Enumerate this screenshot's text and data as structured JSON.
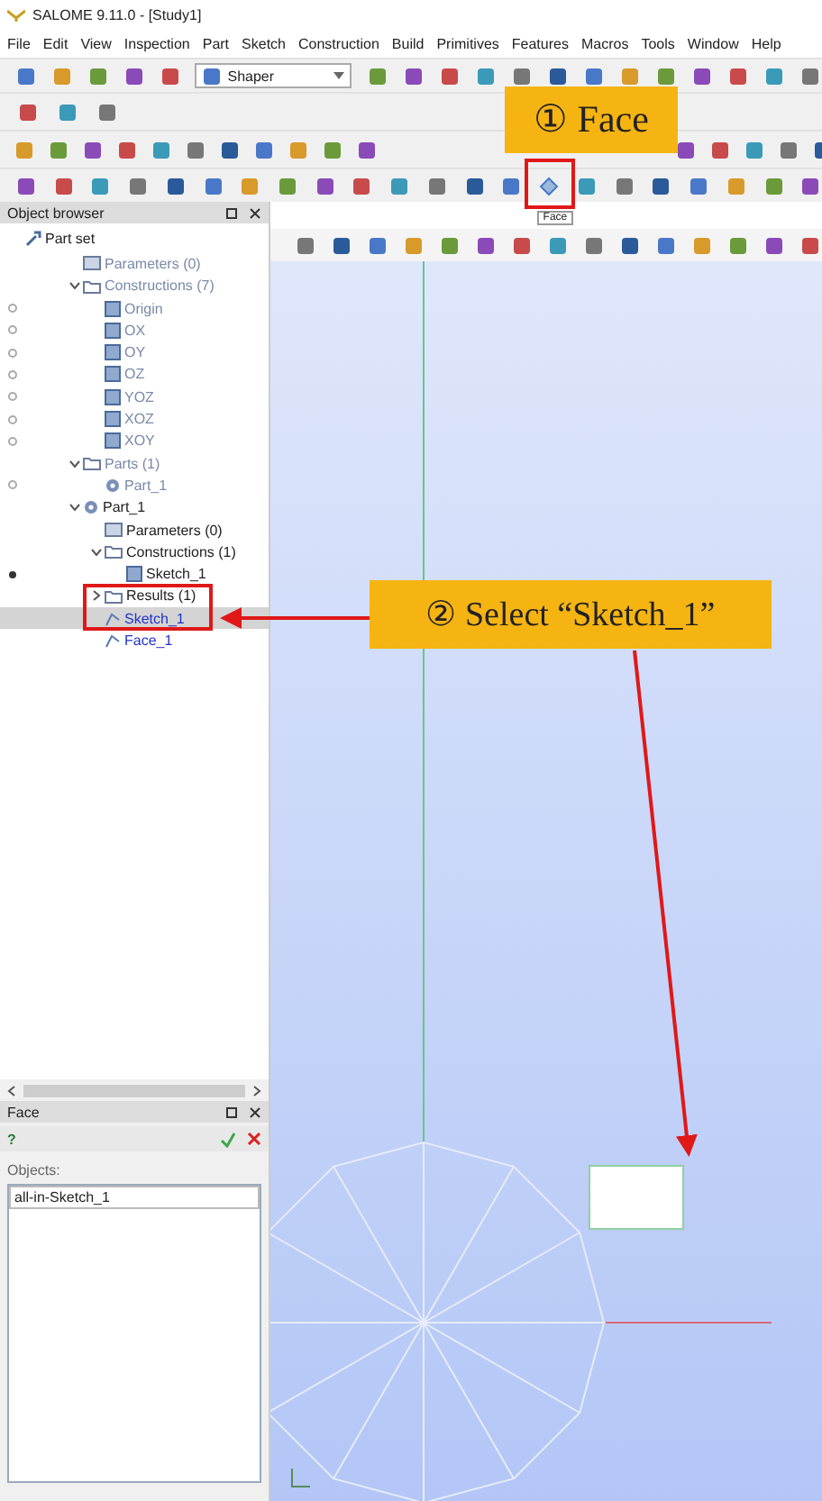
{
  "window": {
    "title": "SALOME 9.11.0 - [Study1]"
  },
  "menu": [
    "File",
    "Edit",
    "View",
    "Inspection",
    "Part",
    "Sketch",
    "Construction",
    "Build",
    "Primitives",
    "Features",
    "Macros",
    "Tools",
    "Window",
    "Help"
  ],
  "module_selector": {
    "value": "Shaper"
  },
  "tooltip": "Face",
  "object_browser": {
    "title": "Object browser",
    "tree": [
      {
        "label": "Part set",
        "kind": "root",
        "selected": false,
        "dimmed": false,
        "children": [
          {
            "label": "Parameters (0)",
            "kind": "params",
            "selected": false,
            "dimmed": true
          },
          {
            "label": "Constructions (7)",
            "kind": "folder",
            "selected": false,
            "dimmed": true,
            "expanded": true,
            "children": [
              {
                "label": "Origin",
                "kind": "construction",
                "selected": false,
                "dimmed": true,
                "visible": false
              },
              {
                "label": "OX",
                "kind": "construction",
                "selected": false,
                "dimmed": true,
                "visible": false
              },
              {
                "label": "OY",
                "kind": "construction",
                "selected": false,
                "dimmed": true,
                "visible": false
              },
              {
                "label": "OZ",
                "kind": "construction",
                "selected": false,
                "dimmed": true,
                "visible": false
              },
              {
                "label": "YOZ",
                "kind": "construction",
                "selected": false,
                "dimmed": true,
                "visible": false
              },
              {
                "label": "XOZ",
                "kind": "construction",
                "selected": false,
                "dimmed": true,
                "visible": false
              },
              {
                "label": "XOY",
                "kind": "construction",
                "selected": false,
                "dimmed": true,
                "visible": false
              }
            ]
          },
          {
            "label": "Parts (1)",
            "kind": "folder",
            "selected": false,
            "dimmed": true,
            "expanded": true,
            "children": [
              {
                "label": "Part_1",
                "kind": "part",
                "selected": false,
                "dimmed": true,
                "visible": false
              }
            ]
          },
          {
            "label": "Part_1",
            "kind": "part",
            "selected": false,
            "dimmed": false,
            "expanded": true,
            "children": [
              {
                "label": "Parameters (0)",
                "kind": "params",
                "selected": false,
                "dimmed": false
              },
              {
                "label": "Constructions (1)",
                "kind": "folder",
                "selected": false,
                "dimmed": false,
                "expanded": true,
                "children": [
                  {
                    "label": "Sketch_1",
                    "kind": "construction",
                    "selected": false,
                    "dimmed": false,
                    "visible": true
                  }
                ]
              },
              {
                "label": "Results (1)",
                "kind": "folder",
                "selected": false,
                "dimmed": false,
                "expanded": false
              },
              {
                "label": "Sketch_1",
                "kind": "feature",
                "selected": true,
                "dimmed": false
              },
              {
                "label": "Face_1",
                "kind": "feature",
                "selected": false,
                "dimmed": false
              }
            ]
          }
        ]
      }
    ]
  },
  "face_panel": {
    "title": "Face",
    "help": "?",
    "objects_label": "Objects:",
    "objects": [
      "all-in-Sketch_1"
    ]
  },
  "annotations": [
    {
      "text": "① Face"
    },
    {
      "text": "② Select “Sketch_1”"
    }
  ]
}
